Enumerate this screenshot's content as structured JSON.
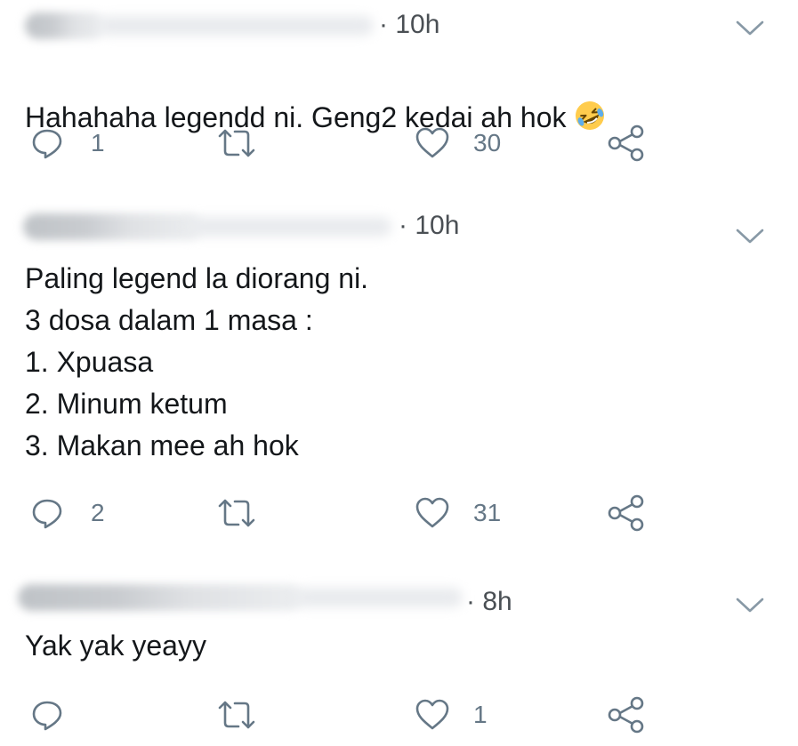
{
  "tweets": [
    {
      "time": "· 10h",
      "text": "Hahahaha legendd ni. Geng2 kedai ah hok",
      "emoji": "rolling-on-floor-laughing-emoji",
      "replies": "1",
      "retweets": "",
      "likes": "30"
    },
    {
      "time": "· 10h",
      "text": "Paling legend la diorang ni.\n3 dosa dalam 1 masa :\n1. Xpuasa\n2. Minum ketum\n3. Makan mee ah hok",
      "replies": "2",
      "retweets": "",
      "likes": "31"
    },
    {
      "time": "· 8h",
      "text": "Yak yak yeayy",
      "replies": "",
      "retweets": "",
      "likes": "1"
    }
  ],
  "icons": {
    "reply": "reply-icon",
    "retweet": "retweet-icon",
    "like": "heart-icon",
    "share": "share-icon",
    "more": "chevron-down-icon"
  },
  "colors": {
    "text": "#14171a",
    "icon": "#657786",
    "time": "#4a4f54"
  }
}
